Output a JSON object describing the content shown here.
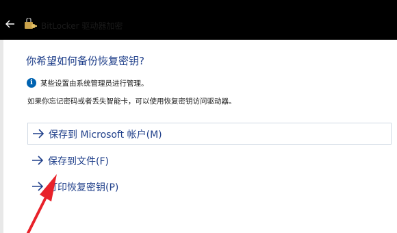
{
  "window": {
    "title": "BitLocker 驱动器加密",
    "back_icon": "back-arrow-icon",
    "app_icon": "bitlocker-key-icon",
    "titlebar_color": "#000000"
  },
  "main": {
    "heading": "你希望如何备份恢复密钥?",
    "info_message": "某些设置由系统管理员进行管理。",
    "description": "如果你忘记密码或者丢失智能卡，可以使用恢复密钥访问驱动器。",
    "accent_color": "#1f3f8a"
  },
  "options": [
    {
      "label": "保存到 Microsoft 帐户(M)",
      "icon": "arrow-right-icon"
    },
    {
      "label": "保存到文件(F)",
      "icon": "arrow-right-icon"
    },
    {
      "label": "打印恢复密钥(P)",
      "icon": "arrow-right-icon"
    }
  ],
  "annotation": {
    "icon": "red-pointer-arrow-icon",
    "color": "#e8222a"
  }
}
